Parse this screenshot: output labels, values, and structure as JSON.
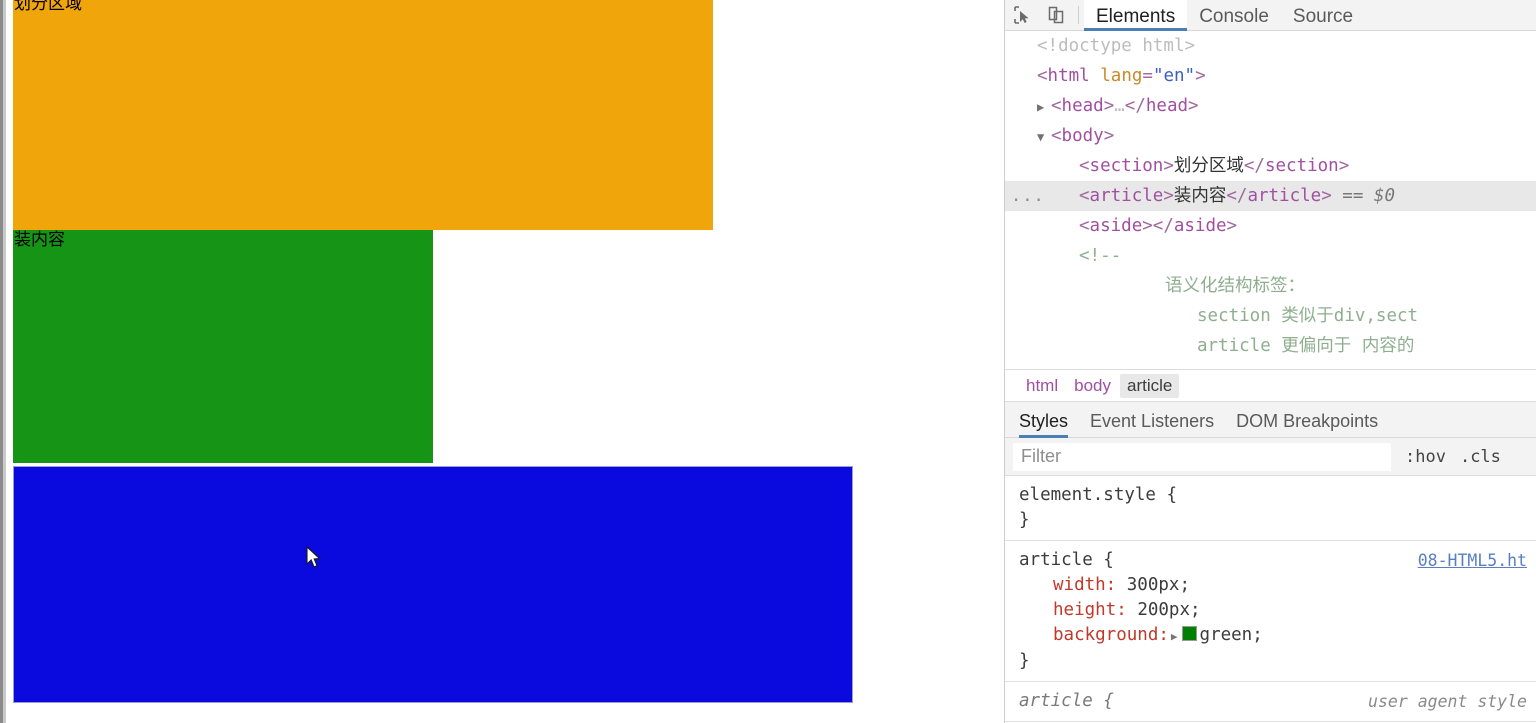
{
  "page": {
    "blocks": [
      {
        "name": "section",
        "text": "划分区域",
        "color": "#f0a50a"
      },
      {
        "name": "article",
        "text": "装内容",
        "color": "#159415"
      },
      {
        "name": "aside",
        "text": "",
        "color": "#0a0adf"
      }
    ]
  },
  "devtools": {
    "toolbar": {
      "inspect_icon": "inspect-element-icon",
      "device_icon": "device-toolbar-icon",
      "tabs": [
        {
          "label": "Elements",
          "active": true
        },
        {
          "label": "Console",
          "active": false
        },
        {
          "label": "Source",
          "active": false
        }
      ]
    },
    "dom": {
      "rows": [
        {
          "indent": 0,
          "arrow": "",
          "content": "doctype",
          "text": "<!doctype html>"
        },
        {
          "indent": 0,
          "arrow": "",
          "content": "html-open",
          "tag": "html",
          "attr": "lang",
          "value": "\"en\""
        },
        {
          "indent": 1,
          "arrow": "▶",
          "content": "head-collapsed",
          "tag": "head",
          "ellipsis": "…"
        },
        {
          "indent": 1,
          "arrow": "▼",
          "content": "body-open",
          "tag": "body"
        },
        {
          "indent": 2,
          "arrow": "",
          "content": "section-node",
          "tag": "section",
          "text": "划分区域"
        },
        {
          "indent": 2,
          "arrow": "",
          "content": "article-node",
          "tag": "article",
          "text": "装内容",
          "selected": true,
          "marker": "== $0",
          "dots": "..."
        },
        {
          "indent": 2,
          "arrow": "",
          "content": "aside-node",
          "tag": "aside",
          "text": ""
        }
      ],
      "comment": {
        "open": "<!--",
        "lines": [
          "语义化结构标签：",
          "section        类似于div,sect",
          "article        更偏向于 内容的"
        ]
      }
    },
    "breadcrumb": [
      {
        "label": "html",
        "active": false
      },
      {
        "label": "body",
        "active": false
      },
      {
        "label": "article",
        "active": true
      }
    ],
    "styles_tabs": [
      {
        "label": "Styles",
        "active": true
      },
      {
        "label": "Event Listeners",
        "active": false
      },
      {
        "label": "DOM Breakpoints",
        "active": false
      }
    ],
    "filter": {
      "placeholder": "Filter",
      "value": "",
      "hov_label": ":hov",
      "cls_label": ".cls"
    },
    "css_rules": [
      {
        "selector": "element.style {",
        "origin": "",
        "declarations": [],
        "close": "}"
      },
      {
        "selector": "article {",
        "origin": "08-HTML5.ht",
        "declarations": [
          {
            "prop": "width:",
            "value": "300px;",
            "swatch": ""
          },
          {
            "prop": "height:",
            "value": "200px;",
            "swatch": ""
          },
          {
            "prop": "background:",
            "value": "green;",
            "swatch": "#008000"
          }
        ],
        "close": "}"
      },
      {
        "selector": "article {",
        "origin": "user agent style",
        "declarations": [],
        "close": ""
      }
    ]
  }
}
